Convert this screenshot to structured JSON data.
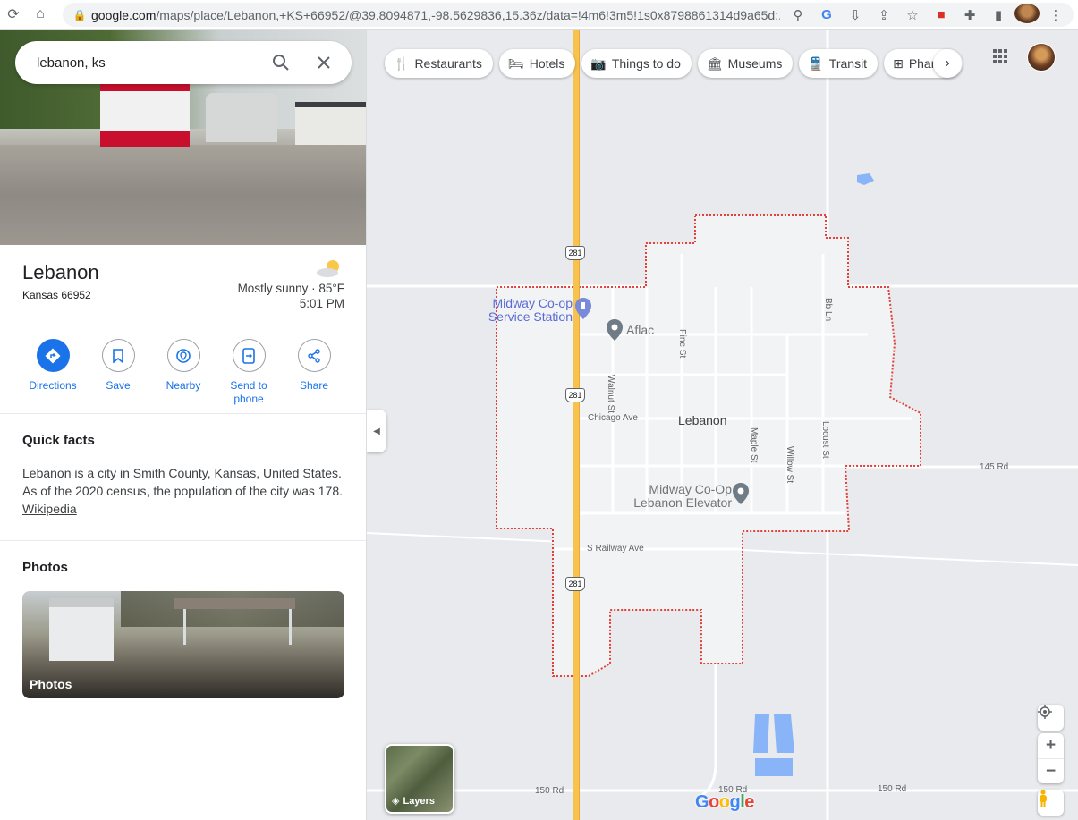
{
  "browser": {
    "url_host": "google.com",
    "url_rest": "/maps/place/Lebanon,+KS+66952/@39.8094871,-98.5629836,15.36z/data=!4m6!3m5!1s0x8798861314d9a65d:..."
  },
  "search": {
    "value": "lebanon, ks"
  },
  "place": {
    "name": "Lebanon",
    "subtitle": "Kansas 66952",
    "weather": "Mostly sunny · 85°F",
    "time": "5:01 PM"
  },
  "actions": [
    {
      "label": "Directions",
      "icon": "directions-icon"
    },
    {
      "label": "Save",
      "icon": "bookmark-icon"
    },
    {
      "label": "Nearby",
      "icon": "nearby-icon"
    },
    {
      "label": "Send to phone",
      "icon": "send-to-phone-icon"
    },
    {
      "label": "Share",
      "icon": "share-icon"
    }
  ],
  "quick_facts": {
    "title": "Quick facts",
    "text": "Lebanon is a city in Smith County, Kansas, United States. As of the 2020 census, the population of the city was 178.",
    "link": "Wikipedia"
  },
  "photos": {
    "title": "Photos",
    "card_label": "Photos"
  },
  "map": {
    "chips": [
      {
        "label": "Restaurants",
        "icon": "fork-knife-icon"
      },
      {
        "label": "Hotels",
        "icon": "bed-icon"
      },
      {
        "label": "Things to do",
        "icon": "camera-icon"
      },
      {
        "label": "Museums",
        "icon": "museum-icon"
      },
      {
        "label": "Transit",
        "icon": "train-icon"
      },
      {
        "label": "Pharm",
        "icon": "pharmacy-icon"
      }
    ],
    "labels": {
      "town": "Lebanon",
      "poi_station_1": "Midway Co-op",
      "poi_station_2": "Service Station",
      "poi_aflac": "Aflac",
      "poi_elevator_1": "Midway Co-Op",
      "poi_elevator_2": "Lebanon Elevator",
      "chicago_ave": "Chicago Ave",
      "s_railway_ave": "S Railway Ave",
      "rd_145": "145 Rd",
      "rd_150_left": "150 Rd",
      "rd_150_mid": "150 Rd",
      "rd_150_right": "150 Rd",
      "walnut": "Walnut St",
      "pine": "Pine St",
      "maple": "Maple St",
      "willow": "Willow St",
      "locust": "Locust St",
      "bb_ln": "Bb Ln",
      "shield": "281"
    },
    "layers_label": "Layers",
    "logo": "Google"
  },
  "colors": {
    "accent": "#1a73e8",
    "highway": "#f7c34e",
    "boundary": "#e2413a",
    "water": "#8ab4f8"
  }
}
